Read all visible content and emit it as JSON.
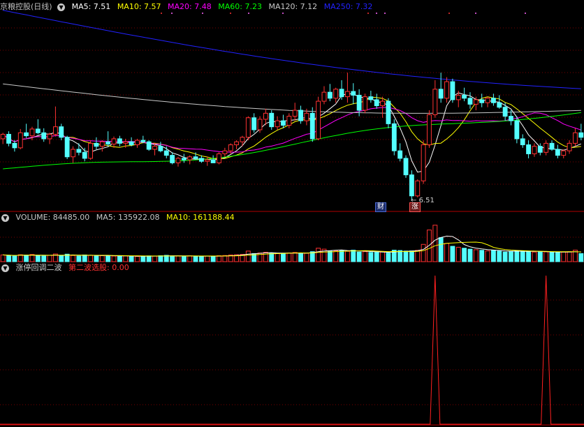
{
  "header": {
    "stock_name": "京粮控股(日线)",
    "ma": [
      {
        "label": "MA5: 7.51",
        "color": "#ffffff"
      },
      {
        "label": "MA10: 7.57",
        "color": "#ffff00"
      },
      {
        "label": "MA20: 7.48",
        "color": "#ff00ff"
      },
      {
        "label": "MA60: 7.23",
        "color": "#00ff00"
      },
      {
        "label": "MA120: 7.12",
        "color": "#c8c8c8"
      },
      {
        "label": "MA250: 7.32",
        "color": "#2222ff"
      }
    ]
  },
  "price_panel": {
    "low_marker": "6.51",
    "event_tags": {
      "cai": "财",
      "zhang": "涨"
    }
  },
  "volume_panel": {
    "title": "VOLUME: 84485.00",
    "ma5": "MA5: 135922.08",
    "ma10": "MA10: 161188.44"
  },
  "indicator_panel": {
    "title": "涨停回调二波",
    "signal": "第二波选股: 0.00"
  },
  "colors": {
    "up": "#ff3232",
    "down": "#54ffff",
    "grid": "#7a0000",
    "panel_border": "#b00000"
  },
  "chart_data": [
    {
      "type": "candlestick",
      "ohlc": [
        [
          7.32,
          7.4,
          7.25,
          7.38
        ],
        [
          7.38,
          7.42,
          7.22,
          7.26
        ],
        [
          7.26,
          7.3,
          7.15,
          7.2
        ],
        [
          7.2,
          7.45,
          7.18,
          7.4
        ],
        [
          7.4,
          7.52,
          7.33,
          7.36
        ],
        [
          7.36,
          7.48,
          7.3,
          7.45
        ],
        [
          7.45,
          7.58,
          7.38,
          7.4
        ],
        [
          7.4,
          7.46,
          7.28,
          7.32
        ],
        [
          7.32,
          7.4,
          7.25,
          7.38
        ],
        [
          7.38,
          7.75,
          7.35,
          7.48
        ],
        [
          7.48,
          7.52,
          7.3,
          7.34
        ],
        [
          7.34,
          7.36,
          7.05,
          7.08
        ],
        [
          7.08,
          7.22,
          7.0,
          7.18
        ],
        [
          7.18,
          7.26,
          7.1,
          7.14
        ],
        [
          7.14,
          7.2,
          7.02,
          7.06
        ],
        [
          7.06,
          7.3,
          7.04,
          7.26
        ],
        [
          7.26,
          7.34,
          7.18,
          7.22
        ],
        [
          7.22,
          7.3,
          7.15,
          7.28
        ],
        [
          7.28,
          7.42,
          7.22,
          7.25
        ],
        [
          7.25,
          7.35,
          7.2,
          7.32
        ],
        [
          7.32,
          7.36,
          7.22,
          7.26
        ],
        [
          7.26,
          7.32,
          7.2,
          7.28
        ],
        [
          7.28,
          7.34,
          7.22,
          7.24
        ],
        [
          7.24,
          7.32,
          7.2,
          7.3
        ],
        [
          7.3,
          7.36,
          7.26,
          7.28
        ],
        [
          7.28,
          7.3,
          7.16,
          7.18
        ],
        [
          7.18,
          7.26,
          7.1,
          7.22
        ],
        [
          7.22,
          7.28,
          7.14,
          7.16
        ],
        [
          7.16,
          7.22,
          7.06,
          7.1
        ],
        [
          7.1,
          7.14,
          6.98,
          7.0
        ],
        [
          7.0,
          7.08,
          6.95,
          7.06
        ],
        [
          7.06,
          7.12,
          7.0,
          7.04
        ],
        [
          7.04,
          7.1,
          6.98,
          7.08
        ],
        [
          7.08,
          7.14,
          7.04,
          7.06
        ],
        [
          7.06,
          7.1,
          7.0,
          7.02
        ],
        [
          7.02,
          7.08,
          6.96,
          7.04
        ],
        [
          7.04,
          7.1,
          7.0,
          7.0
        ],
        [
          7.0,
          7.14,
          6.98,
          7.12
        ],
        [
          7.12,
          7.2,
          7.08,
          7.16
        ],
        [
          7.16,
          7.26,
          7.12,
          7.24
        ],
        [
          7.24,
          7.3,
          7.18,
          7.28
        ],
        [
          7.28,
          7.36,
          7.22,
          7.34
        ],
        [
          7.34,
          7.62,
          7.3,
          7.6
        ],
        [
          7.6,
          7.66,
          7.4,
          7.44
        ],
        [
          7.44,
          7.62,
          7.4,
          7.58
        ],
        [
          7.58,
          7.72,
          7.5,
          7.66
        ],
        [
          7.66,
          7.7,
          7.44,
          7.48
        ],
        [
          7.48,
          7.62,
          7.44,
          7.56
        ],
        [
          7.56,
          7.64,
          7.46,
          7.5
        ],
        [
          7.5,
          7.66,
          7.46,
          7.62
        ],
        [
          7.62,
          7.8,
          7.56,
          7.7
        ],
        [
          7.7,
          7.76,
          7.52,
          7.56
        ],
        [
          7.56,
          7.72,
          7.5,
          7.66
        ],
        [
          7.66,
          7.74,
          7.28,
          7.32
        ],
        [
          7.32,
          7.88,
          7.3,
          7.82
        ],
        [
          7.82,
          8.02,
          7.78,
          7.94
        ],
        [
          7.94,
          8.05,
          7.82,
          7.86
        ],
        [
          7.86,
          8.0,
          7.8,
          7.98
        ],
        [
          7.98,
          8.1,
          7.84,
          7.88
        ],
        [
          7.88,
          8.2,
          7.8,
          7.95
        ],
        [
          7.95,
          8.06,
          7.78,
          7.9
        ],
        [
          7.9,
          7.98,
          7.62,
          7.7
        ],
        [
          7.7,
          7.92,
          7.66,
          7.88
        ],
        [
          7.88,
          7.96,
          7.8,
          7.84
        ],
        [
          7.84,
          7.92,
          7.72,
          7.76
        ],
        [
          7.76,
          7.88,
          7.6,
          7.82
        ],
        [
          7.82,
          7.86,
          7.46,
          7.52
        ],
        [
          7.52,
          7.58,
          7.1,
          7.16
        ],
        [
          7.16,
          7.26,
          7.02,
          7.06
        ],
        [
          7.06,
          7.1,
          6.8,
          6.84
        ],
        [
          6.84,
          6.9,
          6.51,
          6.56
        ],
        [
          6.56,
          6.78,
          6.54,
          6.76
        ],
        [
          6.76,
          7.3,
          6.72,
          7.24
        ],
        [
          7.24,
          7.7,
          7.2,
          7.64
        ],
        [
          7.64,
          8.1,
          7.6,
          7.98
        ],
        [
          7.98,
          8.2,
          7.8,
          7.86
        ],
        [
          7.86,
          8.14,
          7.8,
          8.08
        ],
        [
          8.08,
          8.12,
          7.8,
          7.84
        ],
        [
          7.84,
          7.96,
          7.74,
          7.9
        ],
        [
          7.9,
          8.0,
          7.82,
          7.86
        ],
        [
          7.86,
          7.94,
          7.72,
          7.78
        ],
        [
          7.78,
          7.88,
          7.7,
          7.84
        ],
        [
          7.84,
          7.92,
          7.74,
          7.8
        ],
        [
          7.8,
          7.88,
          7.74,
          7.86
        ],
        [
          7.86,
          7.92,
          7.76,
          7.8
        ],
        [
          7.8,
          7.9,
          7.72,
          7.74
        ],
        [
          7.74,
          7.8,
          7.56,
          7.62
        ],
        [
          7.62,
          7.7,
          7.5,
          7.56
        ],
        [
          7.56,
          7.62,
          7.26,
          7.32
        ],
        [
          7.32,
          7.38,
          7.2,
          7.24
        ],
        [
          7.24,
          7.3,
          7.06,
          7.12
        ],
        [
          7.12,
          7.26,
          7.08,
          7.22
        ],
        [
          7.22,
          7.26,
          7.1,
          7.14
        ],
        [
          7.14,
          7.3,
          7.1,
          7.26
        ],
        [
          7.26,
          7.3,
          7.16,
          7.18
        ],
        [
          7.18,
          7.24,
          7.06,
          7.1
        ],
        [
          7.1,
          7.18,
          7.06,
          7.16
        ],
        [
          7.16,
          7.3,
          7.12,
          7.26
        ],
        [
          7.26,
          7.46,
          7.22,
          7.4
        ],
        [
          7.4,
          7.52,
          7.3,
          7.34
        ]
      ],
      "volume": [
        70,
        65,
        60,
        72,
        68,
        75,
        62,
        58,
        66,
        80,
        60,
        78,
        64,
        58,
        70,
        66,
        60,
        62,
        64,
        58,
        56,
        60,
        58,
        54,
        56,
        60,
        58,
        62,
        66,
        60,
        58,
        56,
        60,
        58,
        54,
        58,
        56,
        62,
        64,
        70,
        72,
        76,
        110,
        84,
        90,
        98,
        88,
        86,
        84,
        90,
        96,
        90,
        88,
        104,
        140,
        130,
        110,
        112,
        118,
        108,
        120,
        100,
        104,
        96,
        98,
        102,
        90,
        120,
        116,
        110,
        112,
        118,
        180,
        330,
        380,
        250,
        190,
        160,
        150,
        140,
        130,
        124,
        118,
        112,
        120,
        110,
        100,
        104,
        116,
        110,
        106,
        100,
        104,
        102,
        98,
        96,
        100,
        104,
        120,
        84
      ],
      "signal": [
        [
          74,
          1
        ],
        [
          93,
          1
        ]
      ]
    }
  ]
}
